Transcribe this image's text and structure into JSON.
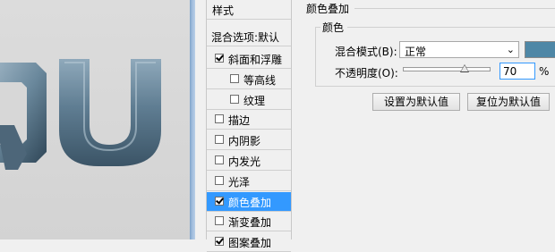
{
  "style_list": {
    "header": "样式",
    "blend_options": "混合选项:默认",
    "items": [
      {
        "label": "斜面和浮雕",
        "checked": true,
        "indent": false,
        "has_checkbox": true
      },
      {
        "label": "等高线",
        "checked": false,
        "indent": true,
        "has_checkbox": true
      },
      {
        "label": "纹理",
        "checked": false,
        "indent": true,
        "has_checkbox": true
      },
      {
        "label": "描边",
        "checked": false,
        "indent": false,
        "has_checkbox": true
      },
      {
        "label": "内阴影",
        "checked": false,
        "indent": false,
        "has_checkbox": true
      },
      {
        "label": "内发光",
        "checked": false,
        "indent": false,
        "has_checkbox": true
      },
      {
        "label": "光泽",
        "checked": false,
        "indent": false,
        "has_checkbox": true
      },
      {
        "label": "颜色叠加",
        "checked": true,
        "indent": false,
        "has_checkbox": true,
        "selected": true
      },
      {
        "label": "渐变叠加",
        "checked": false,
        "indent": false,
        "has_checkbox": true
      },
      {
        "label": "图案叠加",
        "checked": true,
        "indent": false,
        "has_checkbox": true
      }
    ]
  },
  "panel": {
    "title": "颜色叠加",
    "group_title": "颜色",
    "blend_mode_label": "混合模式(B):",
    "blend_mode_value": "正常",
    "overlay_color": "#4e87a6",
    "opacity_label": "不透明度(O):",
    "opacity_value": "70",
    "opacity_unit": "%",
    "opacity_fraction": 0.7,
    "set_default_button": "设置为默认值",
    "reset_default_button": "复位为默认值"
  },
  "canvas": {
    "preview_text": "QU",
    "metal_color": "#5f7d92"
  },
  "icons": {
    "chevron": "chevron-down-icon",
    "checkbox": "checkbox-icon"
  }
}
